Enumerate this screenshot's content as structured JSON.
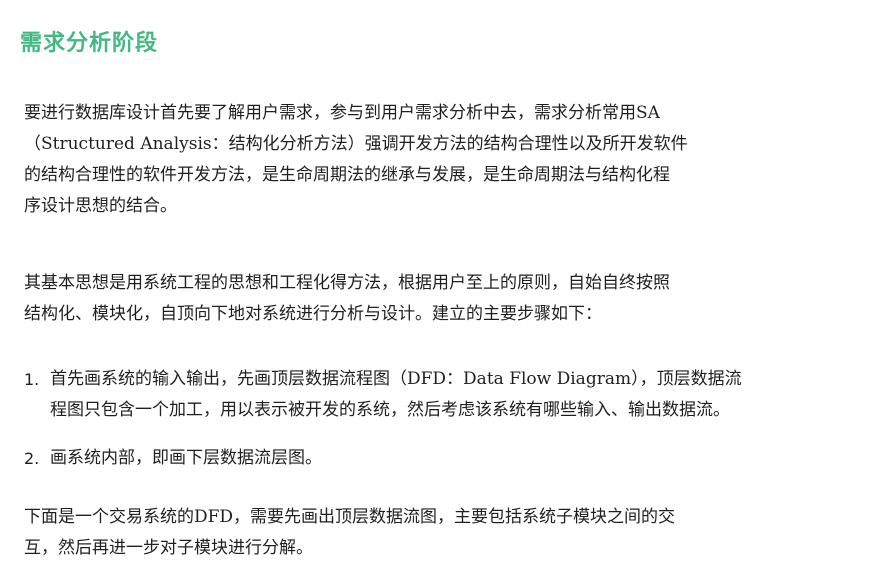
{
  "heading": "需求分析阶段",
  "paragraph1": {
    "lines": [
      "要进行数据库设计首先要了解用户需求，参与到用户需求分析中去，需求分析常用SA",
      "（Structured Analysis：结构化分析方法）强调开发方法的结构合理性以及所开发软件",
      "的结构合理性的软件开发方法，是生命周期法的继承与发展，是生命周期法与结构化程",
      "序设计思想的结合。"
    ]
  },
  "paragraph2": {
    "lines": [
      "其基本思想是用系统工程的思想和工程化得方法，根据用户至上的原则，自始自终按照",
      "结构化、模块化，自顶向下地对系统进行分析与设计。建立的主要步骤如下："
    ]
  },
  "steps": [
    {
      "number": "1.",
      "lines": [
        "首先画系统的输入输出，先画顶层数据流程图（DFD：Data Flow Diagram），顶层数据流",
        "程图只包含一个加工，用以表示被开发的系统，然后考虑该系统有哪些输入、输出数据流。"
      ]
    },
    {
      "number": "2.",
      "lines": [
        "画系统内部，即画下层数据流层图。"
      ]
    }
  ],
  "paragraph3": {
    "lines": [
      "下面是一个交易系统的DFD，需要先画出顶层数据流图，主要包括系统子模块之间的交",
      "互，然后再进一步对子模块进行分解。"
    ]
  }
}
